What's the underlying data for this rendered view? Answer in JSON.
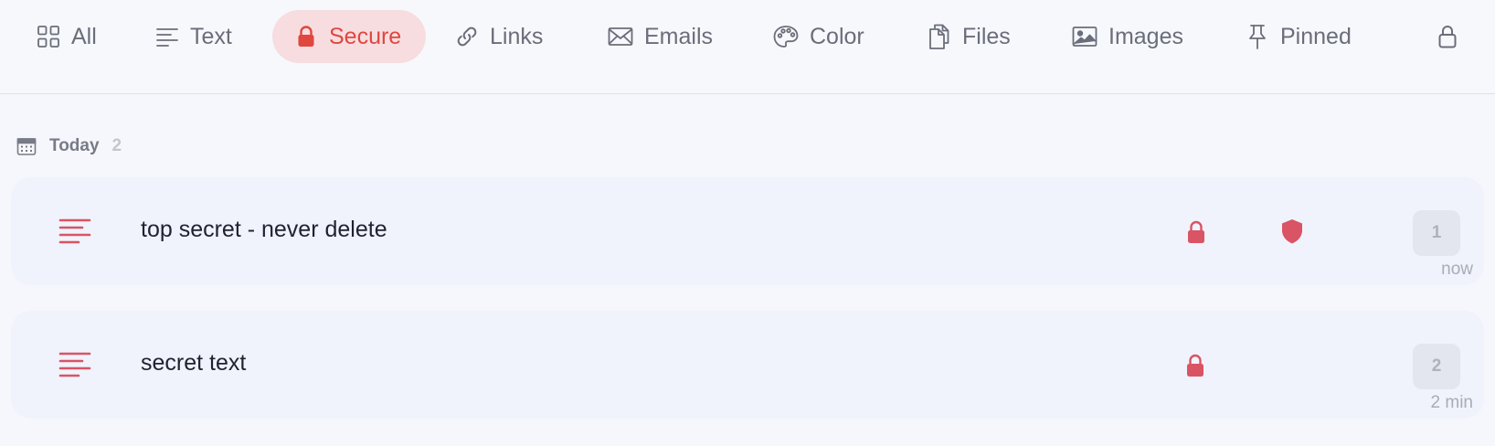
{
  "tabs": [
    {
      "label": "All",
      "icon": "grid-icon",
      "active": false
    },
    {
      "label": "Text",
      "icon": "text-lines-icon",
      "active": false
    },
    {
      "label": "Secure",
      "icon": "lock-icon",
      "active": true
    },
    {
      "label": "Links",
      "icon": "link-icon",
      "active": false
    },
    {
      "label": "Emails",
      "icon": "envelope-icon",
      "active": false
    },
    {
      "label": "Color",
      "icon": "palette-icon",
      "active": false
    },
    {
      "label": "Files",
      "icon": "files-icon",
      "active": false
    },
    {
      "label": "Images",
      "icon": "image-icon",
      "active": false
    },
    {
      "label": "Pinned",
      "icon": "pin-icon",
      "active": false
    }
  ],
  "toolbar": {
    "lock_icon": "lock-outline-icon"
  },
  "section": {
    "label": "Today",
    "count": "2",
    "icon": "calendar-icon"
  },
  "items": [
    {
      "title": "top secret - never delete",
      "index": "1",
      "time": "now",
      "locked": true,
      "shielded": true
    },
    {
      "title": "secret text",
      "index": "2",
      "time": "2 min",
      "locked": true,
      "shielded": false
    }
  ],
  "colors": {
    "accent": "#e0473f",
    "accent_bg": "#f7dde0",
    "item_icon": "#d95464",
    "text_muted": "#6a6e7a"
  }
}
